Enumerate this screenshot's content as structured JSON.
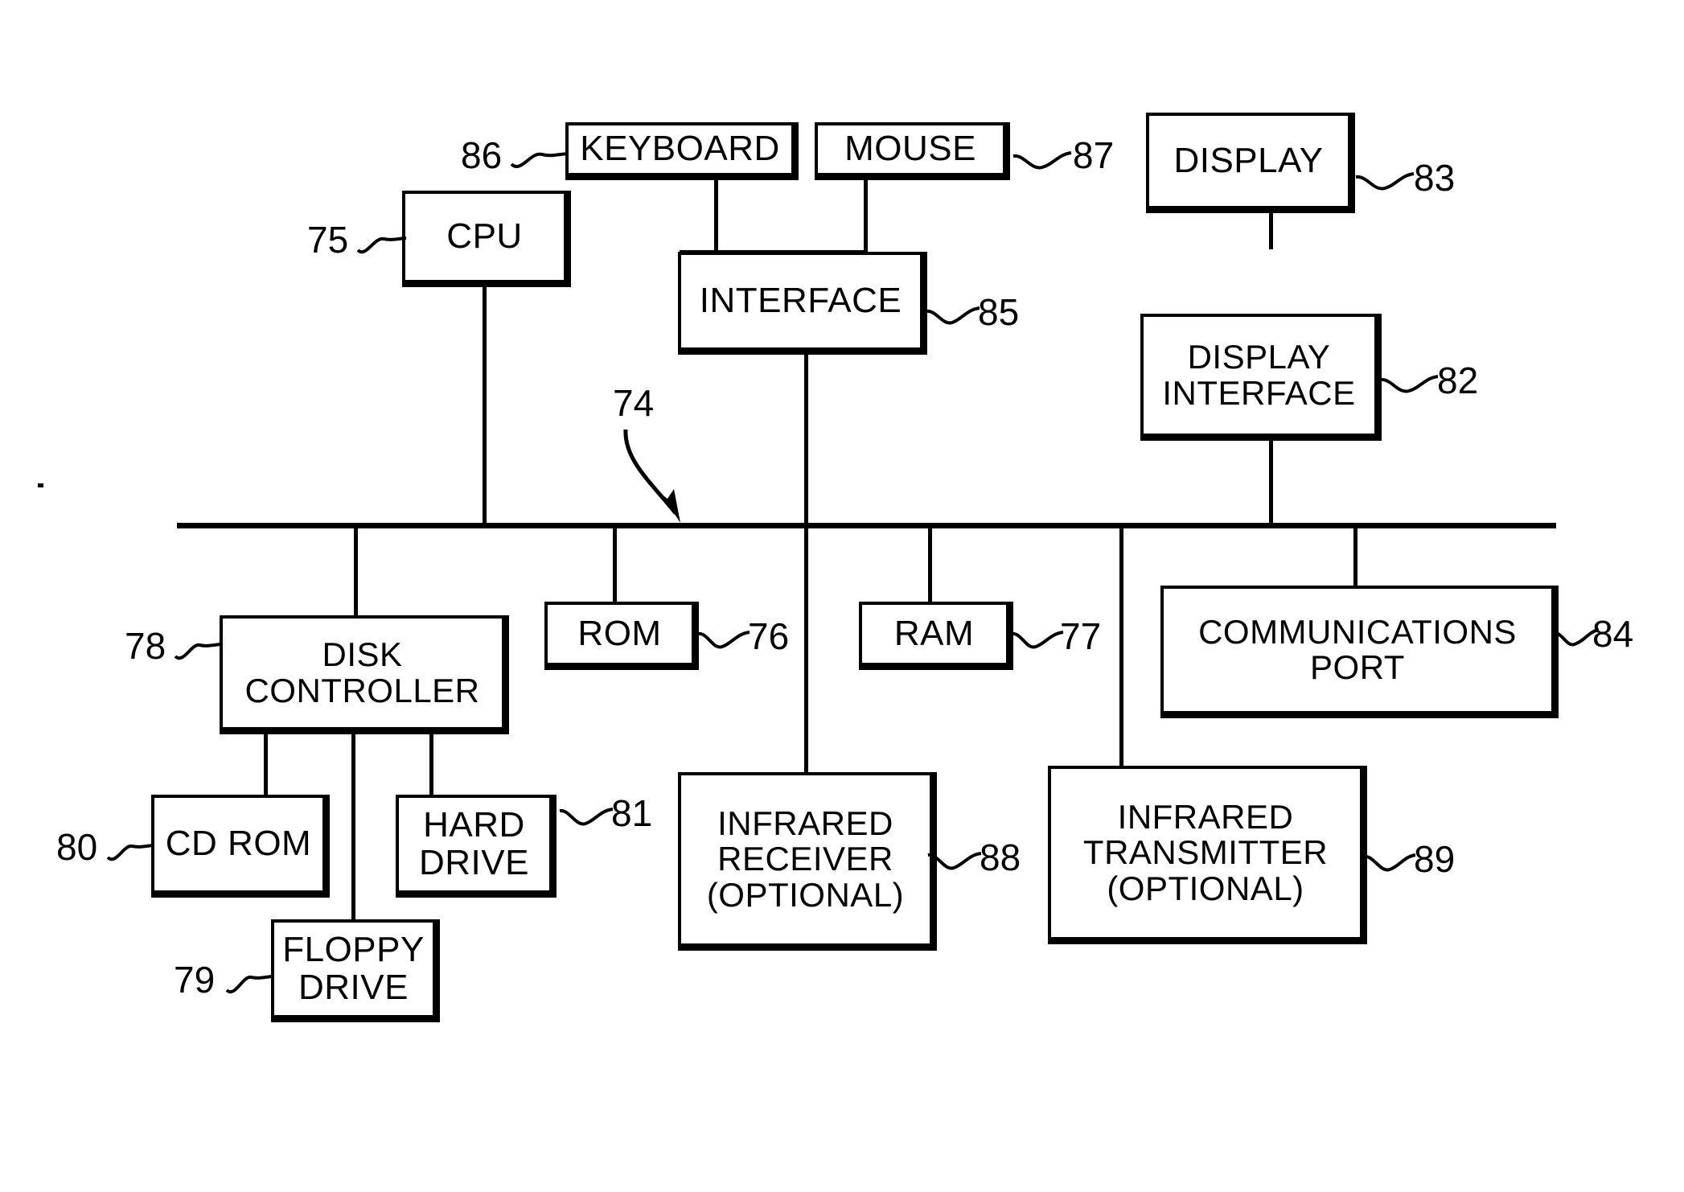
{
  "figure": {
    "type": "patent-block-diagram",
    "title": "Computer system block diagram",
    "background_color": "#ffffff",
    "line_color": "#000000"
  },
  "bus": {
    "label": "74",
    "name": "system-bus"
  },
  "blocks": {
    "keyboard": {
      "label": "KEYBOARD",
      "ref": "86"
    },
    "mouse": {
      "label": "MOUSE",
      "ref": "87"
    },
    "display": {
      "label": "DISPLAY",
      "ref": "83"
    },
    "cpu": {
      "label": "CPU",
      "ref": "75"
    },
    "interface": {
      "label": "INTERFACE",
      "ref": "85"
    },
    "display_interface": {
      "label": "DISPLAY\nINTERFACE",
      "ref": "82"
    },
    "disk_controller": {
      "label": "DISK\nCONTROLLER",
      "ref": "78"
    },
    "rom": {
      "label": "ROM",
      "ref": "76"
    },
    "ram": {
      "label": "RAM",
      "ref": "77"
    },
    "communications_port": {
      "label": "COMMUNICATIONS\nPORT",
      "ref": "84"
    },
    "cd_rom": {
      "label": "CD ROM",
      "ref": "80"
    },
    "hard_drive": {
      "label": "HARD\nDRIVE",
      "ref": "81"
    },
    "floppy_drive": {
      "label": "FLOPPY\nDRIVE",
      "ref": "79"
    },
    "infrared_receiver": {
      "label": "INFRARED\nRECEIVER\n(OPTIONAL)",
      "ref": "88"
    },
    "infrared_transmitter": {
      "label": "INFRARED\nTRANSMITTER\n(OPTIONAL)",
      "ref": "89"
    }
  }
}
